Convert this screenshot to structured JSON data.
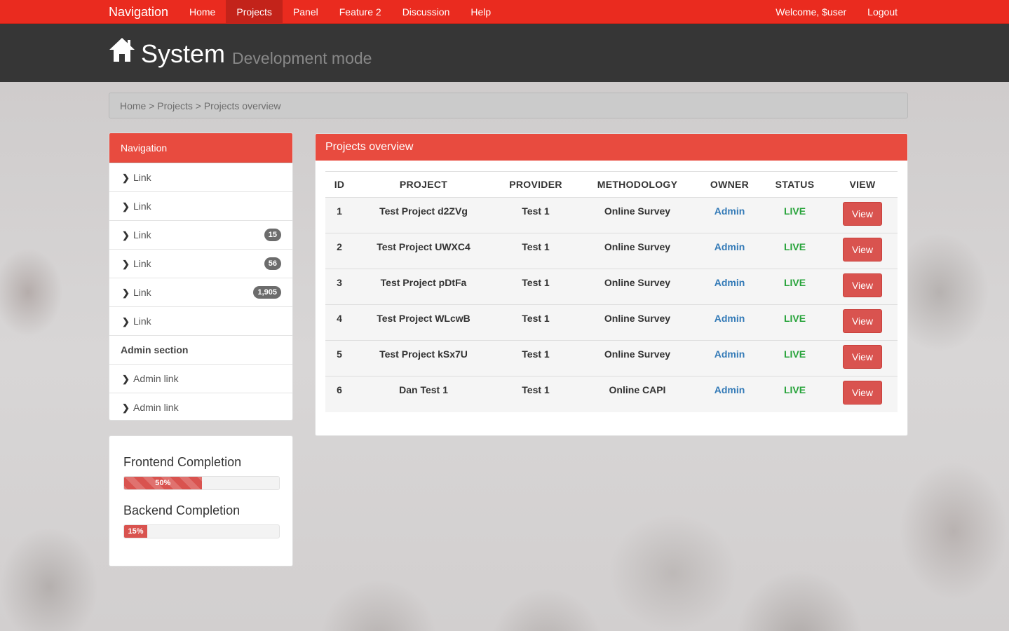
{
  "navbar": {
    "brand": "Navigation",
    "links": [
      "Home",
      "Projects",
      "Panel",
      "Feature 2",
      "Discussion",
      "Help"
    ],
    "active": "Projects",
    "welcome": "Welcome, $user",
    "logout": "Logout"
  },
  "header": {
    "icon": "home-icon",
    "title": "System",
    "subtitle": "Development mode"
  },
  "breadcrumb": "Home > Projects > Projects overview",
  "sidenav": {
    "title": "Navigation",
    "items": [
      {
        "label": "Link",
        "badge": null
      },
      {
        "label": "Link",
        "badge": null
      },
      {
        "label": "Link",
        "badge": "15"
      },
      {
        "label": "Link",
        "badge": "56"
      },
      {
        "label": "Link",
        "badge": "1,905"
      },
      {
        "label": "Link",
        "badge": null
      }
    ],
    "admin_section": "Admin section",
    "admin_items": [
      "Admin link",
      "Admin link"
    ]
  },
  "progress": {
    "frontend": {
      "label": "Frontend Completion",
      "value": 50,
      "text": "50%"
    },
    "backend": {
      "label": "Backend Completion",
      "value": 15,
      "text": "15%"
    }
  },
  "projects": {
    "title": "Projects overview",
    "columns": [
      "ID",
      "PROJECT",
      "PROVIDER",
      "METHODOLOGY",
      "OWNER",
      "STATUS",
      "VIEW"
    ],
    "rows": [
      {
        "id": "1",
        "project": "Test Project d2ZVg",
        "provider": "Test 1",
        "methodology": "Online Survey",
        "owner": "Admin",
        "status": "LIVE",
        "view": "View"
      },
      {
        "id": "2",
        "project": "Test Project UWXC4",
        "provider": "Test 1",
        "methodology": "Online Survey",
        "owner": "Admin",
        "status": "LIVE",
        "view": "View"
      },
      {
        "id": "3",
        "project": "Test Project pDtFa",
        "provider": "Test 1",
        "methodology": "Online Survey",
        "owner": "Admin",
        "status": "LIVE",
        "view": "View"
      },
      {
        "id": "4",
        "project": "Test Project WLcwB",
        "provider": "Test 1",
        "methodology": "Online Survey",
        "owner": "Admin",
        "status": "LIVE",
        "view": "View"
      },
      {
        "id": "5",
        "project": "Test Project kSx7U",
        "provider": "Test 1",
        "methodology": "Online Survey",
        "owner": "Admin",
        "status": "LIVE",
        "view": "View"
      },
      {
        "id": "6",
        "project": "Dan Test 1",
        "provider": "Test 1",
        "methodology": "Online CAPI",
        "owner": "Admin",
        "status": "LIVE",
        "view": "View"
      }
    ]
  },
  "colors": {
    "accent": "#ea2b1f",
    "panel_head": "#e84b3f",
    "header_bg": "#363636",
    "live": "#27a33a",
    "owner_link": "#337ab7"
  }
}
